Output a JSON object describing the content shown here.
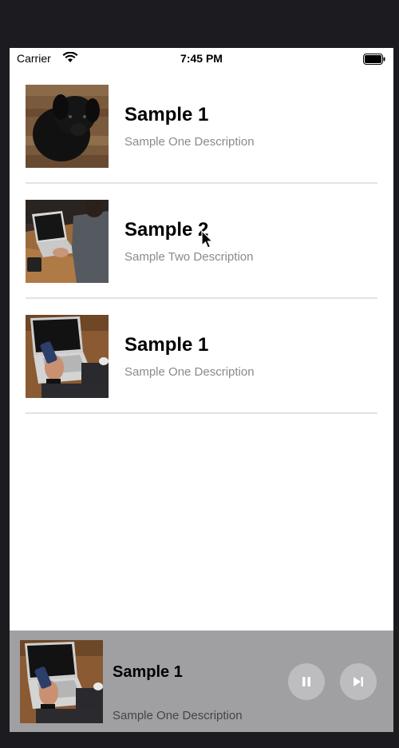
{
  "status_bar": {
    "carrier": "Carrier",
    "time": "7:45 PM"
  },
  "list": {
    "items": [
      {
        "title": "Sample 1",
        "description": "Sample One Description",
        "image": "black-puppy-photo"
      },
      {
        "title": "Sample 2",
        "description": "Sample Two Description",
        "image": "laptop-typing-photo"
      },
      {
        "title": "Sample 1",
        "description": "Sample One Description",
        "image": "phone-and-laptop-photo"
      }
    ]
  },
  "player": {
    "title": "Sample 1",
    "description": "Sample One Description",
    "image": "phone-and-laptop-photo",
    "controls": [
      "pause-icon",
      "skip-next-icon"
    ]
  }
}
